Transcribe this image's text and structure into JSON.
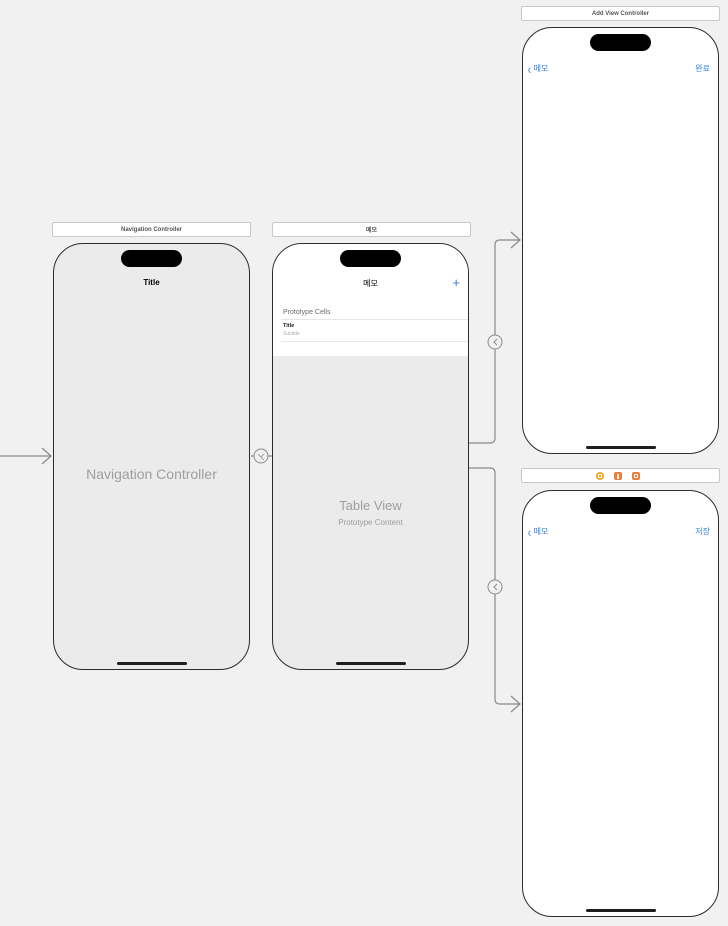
{
  "scenes": {
    "navigation_controller": {
      "header": "Navigation Controller",
      "nav_title": "Title",
      "center_label": "Navigation Controller"
    },
    "memo": {
      "header": "메모",
      "nav_title": "메모",
      "add_icon": "+",
      "section_header": "Prototype Cells",
      "cell_title": "Title",
      "cell_subtitle": "Subtitle",
      "table_view_label": "Table View",
      "prototype_content_label": "Prototype Content"
    },
    "add_view_controller": {
      "header": "Add View Controller",
      "back_label": "메모",
      "right_button": "완료"
    },
    "detail_view_controller": {
      "header": "",
      "back_label": "메모",
      "right_button": "저장"
    }
  },
  "icons": {
    "back_chevron": "‹",
    "scene_dock": [
      "view-controller-icon",
      "first-responder-icon",
      "exit-icon"
    ]
  },
  "colors": {
    "canvas": "#f1f1f1",
    "tint": "#2f7fe0",
    "segue_line": "#8a8a8a",
    "dock_yellow": "#f2a81d",
    "dock_orange": "#ef7d3a"
  }
}
